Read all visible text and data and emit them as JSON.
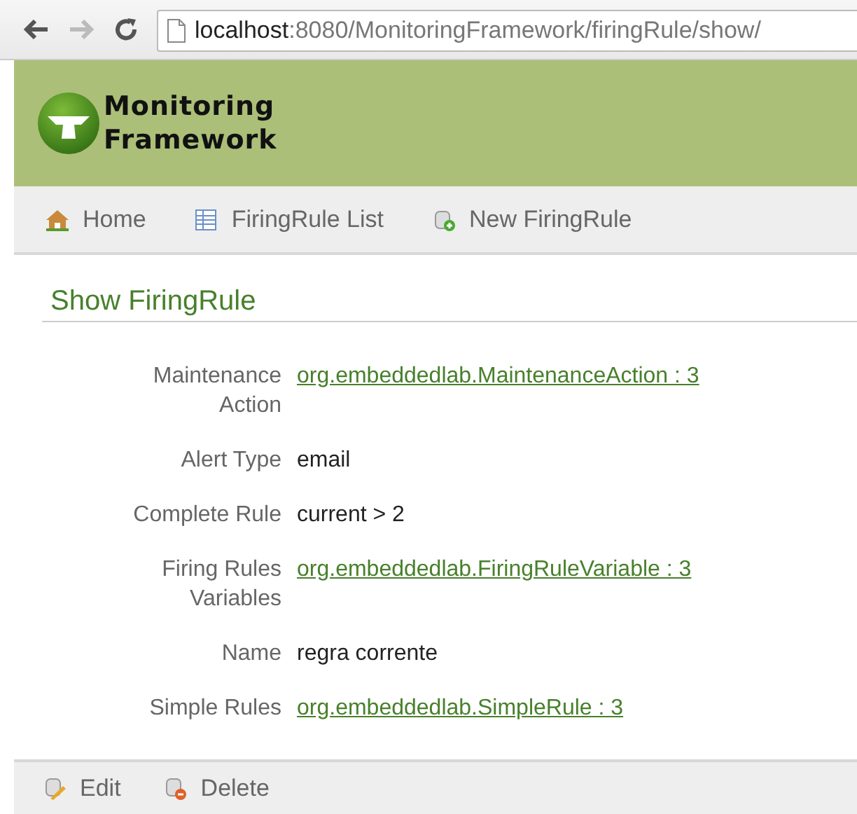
{
  "browser": {
    "address_host": "localhost",
    "address_path": ":8080/MonitoringFramework/firingRule/show/"
  },
  "header": {
    "logo_line1": "Monitoring",
    "logo_line2": "Framework"
  },
  "nav": [
    {
      "kind": "home",
      "label": "Home"
    },
    {
      "kind": "list",
      "label": "FiringRule List"
    },
    {
      "kind": "create",
      "label": "New FiringRule"
    }
  ],
  "title": "Show FiringRule",
  "properties": [
    {
      "label": "Maintenance Action",
      "value": "org.embeddedlab.MaintenanceAction : 3",
      "kind": "link"
    },
    {
      "label": "Alert Type",
      "value": "email",
      "kind": "text"
    },
    {
      "label": "Complete Rule",
      "value": "current > 2",
      "kind": "text"
    },
    {
      "label": "Firing Rules Variables",
      "value": "org.embeddedlab.FiringRuleVariable : 3",
      "kind": "link"
    },
    {
      "label": "Name",
      "value": "regra corrente",
      "kind": "text"
    },
    {
      "label": "Simple Rules",
      "value": "org.embeddedlab.SimpleRule : 3",
      "kind": "link"
    }
  ],
  "actions": [
    {
      "kind": "edit",
      "label": "Edit"
    },
    {
      "kind": "delete",
      "label": "Delete"
    }
  ]
}
